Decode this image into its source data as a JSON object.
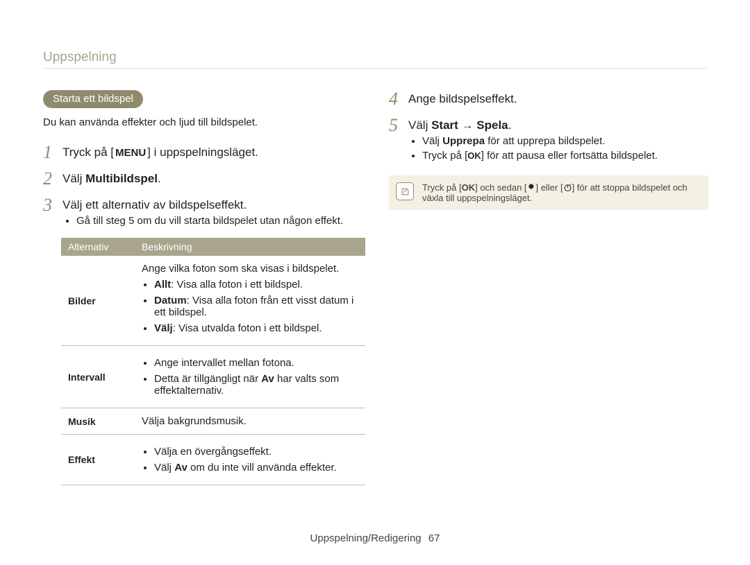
{
  "header": "Uppspelning",
  "pill": "Starta ett bildspel",
  "intro": "Du kan använda effekter och ljud till bildspelet.",
  "menu_glyph": "MENU",
  "ok_glyph": "OK",
  "arrow_glyph": "→",
  "steps_left": {
    "s1_pre": "Tryck på [",
    "s1_post": "] i uppspelningsläget.",
    "s2_pre": "Välj ",
    "s2_bold": "Multibildspel",
    "s2_post": ".",
    "s3": "Välj ett alternativ av bildspelseffekt.",
    "s3_sub": "Gå till steg 5 om du vill starta bildspelet utan någon effekt."
  },
  "table": {
    "header_a": "Alternativ",
    "header_b": "Beskrivning",
    "bilder_label": "Bilder",
    "bilder_intro": "Ange vilka foton som ska visas i bildspelet.",
    "bilder_allt_b": "Allt",
    "bilder_allt_t": ": Visa alla foton i ett bildspel.",
    "bilder_datum_b": "Datum",
    "bilder_datum_t": ": Visa alla foton från ett visst datum i ett bildspel.",
    "bilder_valj_b": "Välj",
    "bilder_valj_t": ": Visa utvalda foton i ett bildspel.",
    "intervall_label": "Intervall",
    "intervall_1": "Ange intervallet mellan fotona.",
    "intervall_2_pre": "Detta är tillgängligt när ",
    "intervall_2_b": "Av",
    "intervall_2_post": " har valts som effektalternativ.",
    "musik_label": "Musik",
    "musik_desc": "Välja bakgrundsmusik.",
    "effekt_label": "Effekt",
    "effekt_1": "Välja en övergångseffekt.",
    "effekt_2_pre": "Välj ",
    "effekt_2_b": "Av",
    "effekt_2_post": " om du inte vill använda effekter."
  },
  "steps_right": {
    "s4": "Ange bildspelseffekt.",
    "s5_pre": "Välj ",
    "s5_b1": "Start",
    "s5_mid": " ",
    "s5_b2": "Spela",
    "s5_post": ".",
    "sub1_pre": "Välj ",
    "sub1_b": "Upprepa",
    "sub1_post": " för att upprepa bildspelet.",
    "sub2_pre": "Tryck på [",
    "sub2_post": "] för att pausa eller fortsätta bildspelet."
  },
  "note": {
    "pre": "Tryck på [",
    "mid1": "] och sedan [",
    "mid2": "] eller [",
    "post": "] för att stoppa bildspelet och växla till uppspelningsläget."
  },
  "footer": {
    "section": "Uppspelning/Redigering",
    "page": "67"
  }
}
